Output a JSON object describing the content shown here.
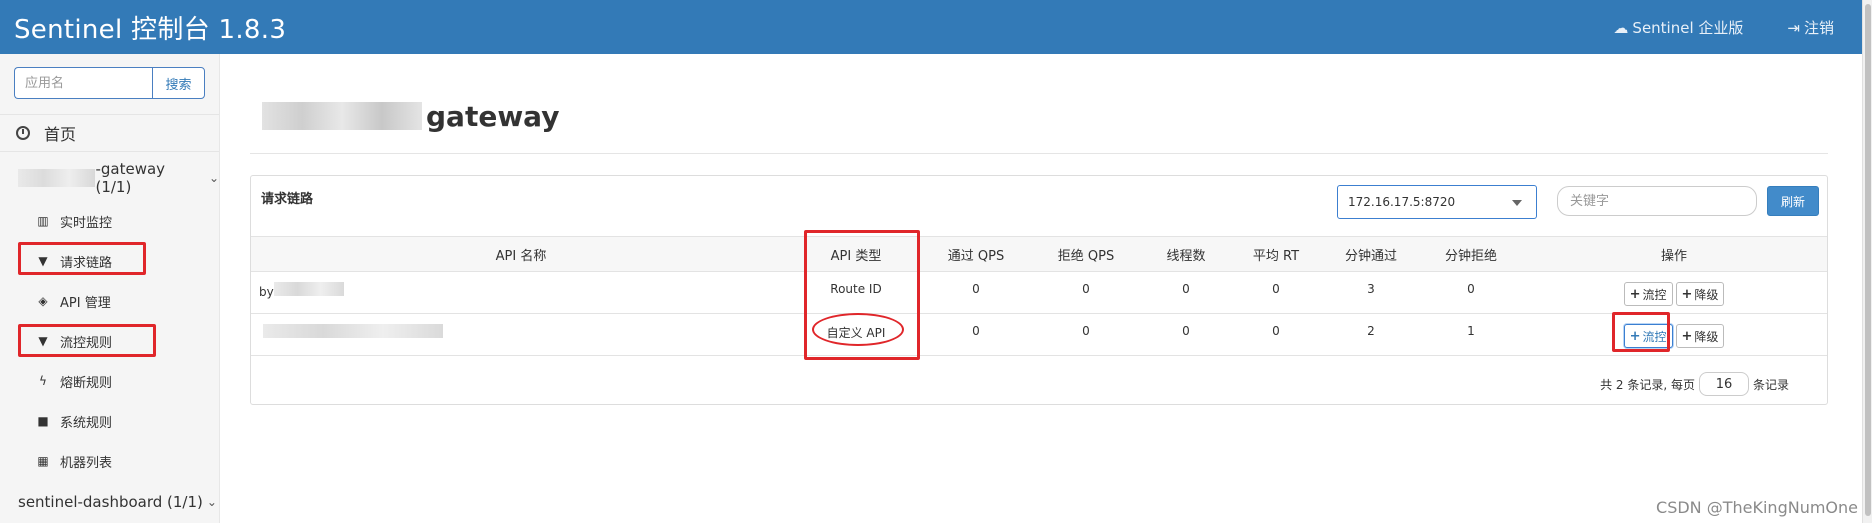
{
  "header": {
    "title": "Sentinel 控制台 1.8.3",
    "enterprise_label": "Sentinel 企业版",
    "logout_label": "注销"
  },
  "sidebar": {
    "search_placeholder": "应用名",
    "search_button": "搜索",
    "home_label": "首页",
    "app1_suffix": "-gateway (1/1)",
    "items": [
      {
        "label": "实时监控",
        "icon": "bar-chart-icon"
      },
      {
        "label": "请求链路",
        "icon": "filter-icon"
      },
      {
        "label": "API 管理",
        "icon": "tags-icon"
      },
      {
        "label": "流控规则",
        "icon": "filter-icon"
      },
      {
        "label": "熔断规则",
        "icon": "flash-icon"
      },
      {
        "label": "系统规则",
        "icon": "lock-icon"
      },
      {
        "label": "机器列表",
        "icon": "th-list-icon"
      }
    ],
    "app2_label": "sentinel-dashboard (1/1)"
  },
  "page": {
    "title_suffix": "gateway",
    "panel_title": "请求链路",
    "machine_value": "172.16.17.5:8720",
    "keyword_placeholder": "关键字",
    "refresh_button": "刷新"
  },
  "table": {
    "headers": [
      "API 名称",
      "API 类型",
      "通过 QPS",
      "拒绝 QPS",
      "线程数",
      "平均 RT",
      "分钟通过",
      "分钟拒绝",
      "操作"
    ],
    "rows": [
      {
        "name_prefix": "by",
        "type": "Route ID",
        "pass_qps": "0",
        "block_qps": "0",
        "threads": "0",
        "avg_rt": "0",
        "minute_pass": "3",
        "minute_block": "0"
      },
      {
        "name_prefix": "",
        "type": "自定义 API",
        "pass_qps": "0",
        "block_qps": "0",
        "threads": "0",
        "avg_rt": "0",
        "minute_pass": "2",
        "minute_block": "1"
      }
    ],
    "flow_button": "流控",
    "degrade_button": "降级"
  },
  "pager": {
    "prefix": "共 2 条记录, 每页",
    "page_size": "16",
    "suffix": "条记录"
  },
  "watermark": "CSDN @TheKingNumOne",
  "colors": {
    "header_bg": "#337ab7",
    "highlight_red": "#e0262a",
    "primary_button": "#428bca"
  }
}
